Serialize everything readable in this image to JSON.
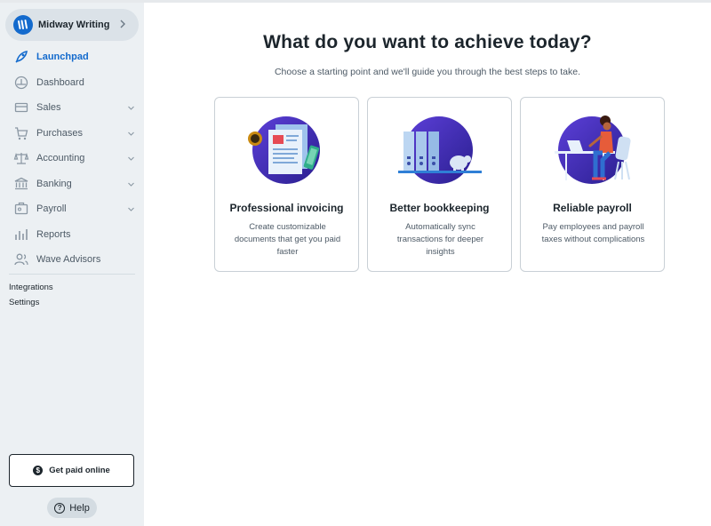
{
  "sidebar": {
    "business_name": "Midway Writing",
    "nav": [
      {
        "label": "Launchpad",
        "icon": "rocket-icon",
        "active": true
      },
      {
        "label": "Dashboard",
        "icon": "dashboard-icon"
      },
      {
        "label": "Sales",
        "icon": "sales-icon",
        "expandable": true
      },
      {
        "label": "Purchases",
        "icon": "cart-icon",
        "expandable": true
      },
      {
        "label": "Accounting",
        "icon": "scale-icon",
        "expandable": true
      },
      {
        "label": "Banking",
        "icon": "bank-icon",
        "expandable": true
      },
      {
        "label": "Payroll",
        "icon": "payroll-icon",
        "expandable": true
      },
      {
        "label": "Reports",
        "icon": "reports-icon"
      },
      {
        "label": "Wave Advisors",
        "icon": "advisors-icon"
      }
    ],
    "links": {
      "integrations": "Integrations",
      "settings": "Settings"
    },
    "get_paid": "Get paid online",
    "help": "Help"
  },
  "main": {
    "title": "What do you want to achieve today?",
    "subtitle": "Choose a starting point and we'll guide you through the best steps to take.",
    "cards": [
      {
        "title": "Professional invoicing",
        "desc": "Create customizable documents that get you paid faster"
      },
      {
        "title": "Better bookkeeping",
        "desc": "Automatically sync transactions for deeper insights"
      },
      {
        "title": "Reliable payroll",
        "desc": "Pay employees and payroll taxes without complications"
      }
    ]
  },
  "colors": {
    "accent": "#136acd",
    "sidebar_bg": "#ecf0f3",
    "illustration_dark": "#3b2aa6",
    "illustration_light": "#5c3fd8"
  }
}
